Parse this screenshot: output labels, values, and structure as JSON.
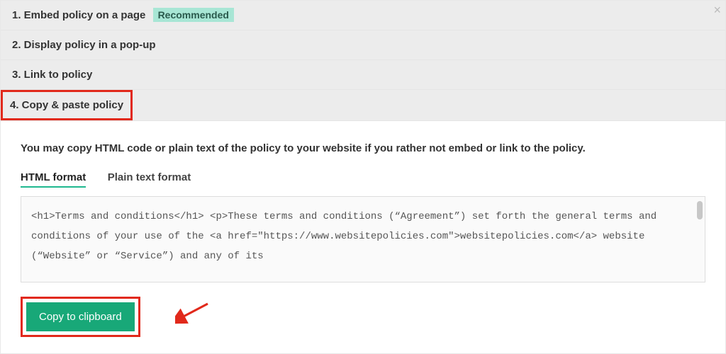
{
  "tabs": [
    {
      "label": "1. Embed policy on a page",
      "badge": "Recommended"
    },
    {
      "label": "2. Display policy in a pop-up"
    },
    {
      "label": "3. Link to policy"
    },
    {
      "label": "4. Copy & paste policy"
    }
  ],
  "content": {
    "description": "You may copy HTML code or plain text of the policy to your website if you rather not embed or link to the policy.",
    "subtabs": [
      "HTML format",
      "Plain text format"
    ],
    "code": "<h1>Terms and conditions</h1>\n<p>These terms and conditions (“Agreement”) set forth the general terms and conditions of your use of the <a href=\"https://www.websitepolicies.com\">websitepolicies.com</a> website (“Website” or “Service”) and any of its",
    "copy_button": "Copy to clipboard"
  }
}
